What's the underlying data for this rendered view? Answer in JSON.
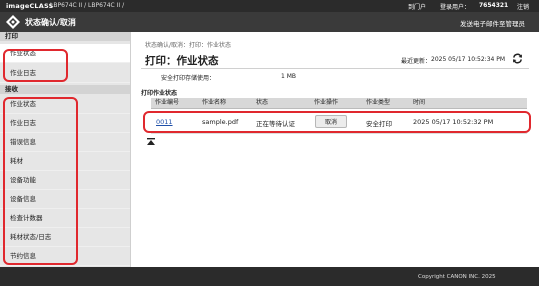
{
  "topbar": {
    "brand": "imageCLASS",
    "model": "LBP674C II / LBP674C II /",
    "portal": "到门户",
    "user_label": "登录用户：",
    "user_id": "7654321",
    "logout": "注销"
  },
  "titlebar": {
    "title": "状态确认/取消",
    "mail": "发送电子邮件至管理员"
  },
  "sidebar": {
    "print_header": "打印",
    "print_items": [
      {
        "label": "作业状态",
        "selected": true
      },
      {
        "label": "作业日志",
        "selected": false
      }
    ],
    "scan_header": "接收",
    "scan_items": [
      {
        "label": "作业状态"
      },
      {
        "label": "作业日志"
      },
      {
        "label": "错误信息"
      },
      {
        "label": "耗材"
      },
      {
        "label": "设备功能"
      },
      {
        "label": "设备信息"
      },
      {
        "label": "检查计数器"
      },
      {
        "label": "耗材状态/日志"
      },
      {
        "label": "节约信息"
      }
    ]
  },
  "main": {
    "breadcrumb": "状态确认/取消：打印：作业状态",
    "title": "打印：作业状态",
    "updated_label": "最近更新：",
    "updated_time": "2025 05/17 10:52:34 PM",
    "storage_label": "安全打印存储使用：",
    "storage_value": "1 MB",
    "section_label": "打印作业状态",
    "table": {
      "headers": [
        "作业编号",
        "作业名称",
        "状态",
        "作业操作",
        "作业类型",
        "时间"
      ],
      "rows": [
        {
          "job_no": "0011",
          "job_name": "sample.pdf",
          "status": "正在等待认证",
          "action": "取消",
          "type": "安全打印",
          "time": "2025 05/17 10:52:32 PM"
        }
      ]
    }
  },
  "footer": {
    "copyright": "Copyright CANON INC. 2025"
  },
  "colors": {
    "highlight": "#e0282e",
    "link": "#1f4fa8",
    "dark_bar": "#2b2b2b"
  }
}
